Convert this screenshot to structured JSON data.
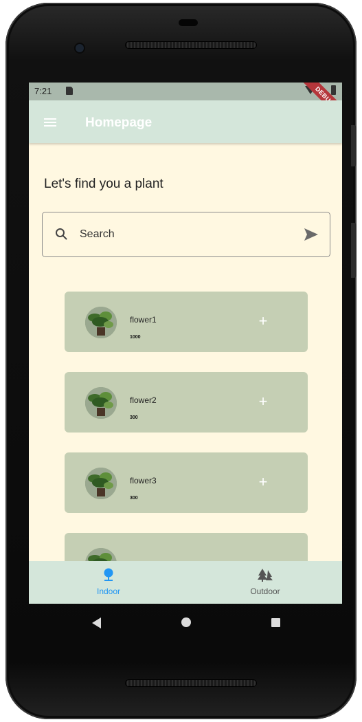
{
  "status_bar": {
    "time": "7:21",
    "debug_banner": "DEBUG"
  },
  "app_bar": {
    "title": "Homepage",
    "menu_icon": "menu-icon"
  },
  "page": {
    "heading": "Let's find you a plant"
  },
  "search": {
    "placeholder": "Search",
    "value": "",
    "search_icon": "search-icon",
    "send_icon": "send-icon"
  },
  "plants": [
    {
      "name": "flower1",
      "price": "1000"
    },
    {
      "name": "flower2",
      "price": "300"
    },
    {
      "name": "flower3",
      "price": "300"
    },
    {
      "name": "",
      "price": ""
    }
  ],
  "add_label": "+",
  "bottom_nav": {
    "items": [
      {
        "label": "Indoor",
        "icon": "indoor-plant-icon",
        "active": true
      },
      {
        "label": "Outdoor",
        "icon": "trees-icon",
        "active": false
      }
    ]
  },
  "colors": {
    "background": "#fff8e1",
    "app_bar": "#d4e6da",
    "card": "#c5cfb4",
    "active_nav": "#2196f3",
    "inactive_nav": "#555555",
    "status_bar": "#a9b8ac"
  }
}
